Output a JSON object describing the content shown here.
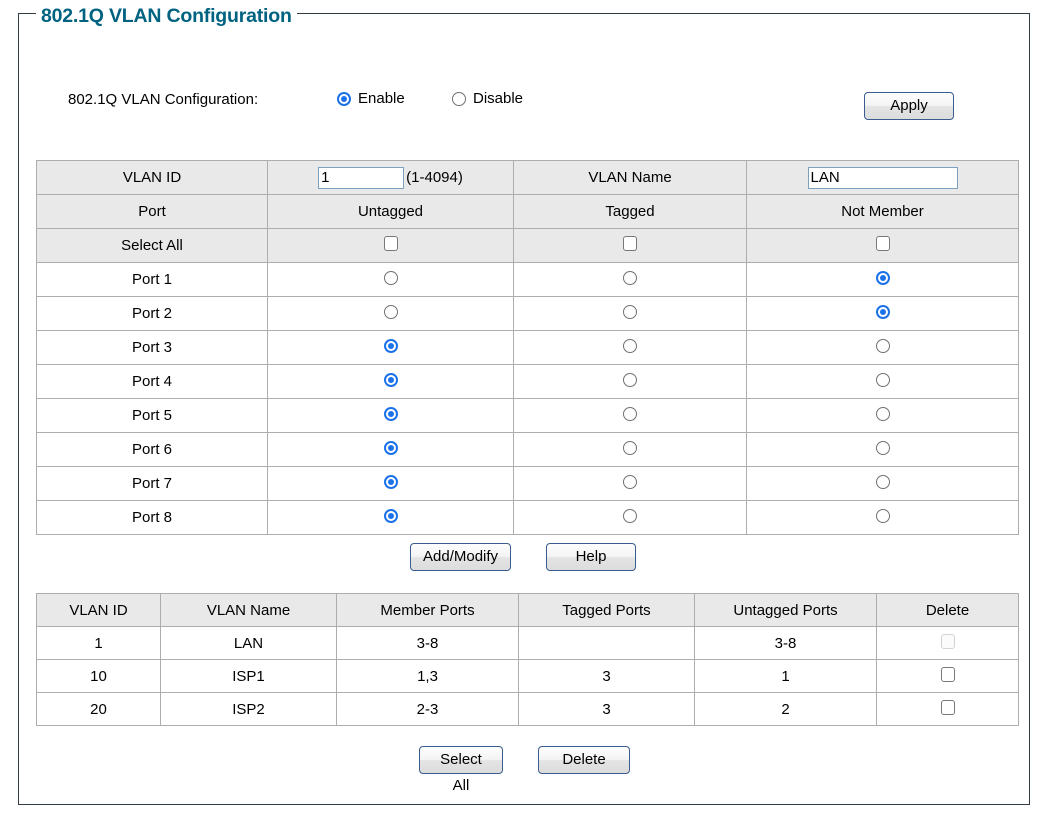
{
  "page": {
    "legend": "802.1Q VLAN Configuration",
    "accent_color": "#006281",
    "frame_border_color": "#313c43",
    "radio_checked_color": "#1b72e8",
    "header_row_bg": "#e9e9e9"
  },
  "config_row": {
    "label": "802.1Q VLAN Configuration:",
    "options": [
      {
        "label": "Enable",
        "checked": true
      },
      {
        "label": "Disable",
        "checked": false
      }
    ],
    "apply_label": "Apply"
  },
  "port_table": {
    "vlan_id_label": "VLAN ID",
    "vlan_id_value": "1",
    "vlan_id_hint": "(1-4094)",
    "vlan_name_label": "VLAN Name",
    "vlan_name_value": "LAN",
    "column_headers": [
      "Port",
      "Untagged",
      "Tagged",
      "Not Member"
    ],
    "select_all_label": "Select All",
    "select_all_checked": [
      false,
      false,
      false
    ],
    "rows": [
      {
        "port": "Port 1",
        "untagged": false,
        "tagged": false,
        "not_member": true
      },
      {
        "port": "Port 2",
        "untagged": false,
        "tagged": false,
        "not_member": true
      },
      {
        "port": "Port 3",
        "untagged": true,
        "tagged": false,
        "not_member": false
      },
      {
        "port": "Port 4",
        "untagged": true,
        "tagged": false,
        "not_member": false
      },
      {
        "port": "Port 5",
        "untagged": true,
        "tagged": false,
        "not_member": false
      },
      {
        "port": "Port 6",
        "untagged": true,
        "tagged": false,
        "not_member": false
      },
      {
        "port": "Port 7",
        "untagged": true,
        "tagged": false,
        "not_member": false
      },
      {
        "port": "Port 8",
        "untagged": true,
        "tagged": false,
        "not_member": false
      }
    ]
  },
  "mid_buttons": {
    "add_modify_label": "Add/Modify",
    "help_label": "Help"
  },
  "summary_table": {
    "column_headers": [
      "VLAN ID",
      "VLAN Name",
      "Member Ports",
      "Tagged Ports",
      "Untagged Ports",
      "Delete"
    ],
    "rows": [
      {
        "vlan_id": "1",
        "vlan_name": "LAN",
        "member_ports": "3-8",
        "tagged_ports": "",
        "untagged_ports": "3-8",
        "delete_checked": false,
        "delete_disabled": true
      },
      {
        "vlan_id": "10",
        "vlan_name": "ISP1",
        "member_ports": "1,3",
        "tagged_ports": "3",
        "untagged_ports": "1",
        "delete_checked": false,
        "delete_disabled": false
      },
      {
        "vlan_id": "20",
        "vlan_name": "ISP2",
        "member_ports": "2-3",
        "tagged_ports": "3",
        "untagged_ports": "2",
        "delete_checked": false,
        "delete_disabled": false
      }
    ]
  },
  "bottom_buttons": {
    "select_all_label": "Select All",
    "delete_label": "Delete"
  }
}
